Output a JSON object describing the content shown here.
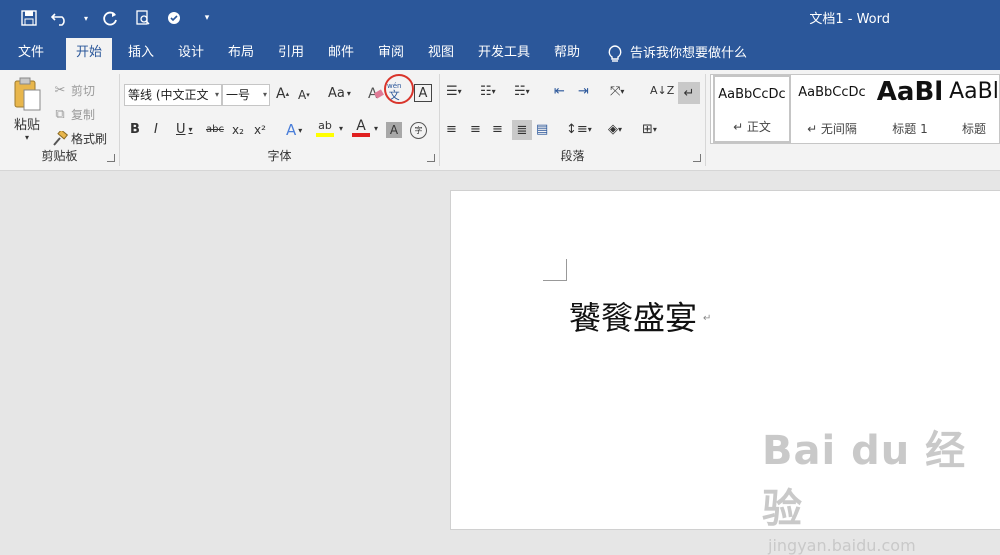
{
  "titlebar": {
    "title": "文档1  -  Word",
    "qat_icons": [
      "save-icon",
      "undo-icon",
      "redo-icon",
      "print-preview-icon",
      "touch-mode-icon",
      "customize-qat-icon"
    ]
  },
  "tabs": [
    {
      "label": "文件"
    },
    {
      "label": "开始"
    },
    {
      "label": "插入"
    },
    {
      "label": "设计"
    },
    {
      "label": "布局"
    },
    {
      "label": "引用"
    },
    {
      "label": "邮件"
    },
    {
      "label": "审阅"
    },
    {
      "label": "视图"
    },
    {
      "label": "开发工具"
    },
    {
      "label": "帮助"
    }
  ],
  "tellme": "告诉我你想要做什么",
  "clipboard": {
    "paste": "粘贴",
    "cut": "剪切",
    "copy": "复制",
    "format_painter": "格式刷",
    "label": "剪贴板"
  },
  "font": {
    "font_name": "等线 (中文正文",
    "font_size": "一号",
    "grow": "A",
    "shrink": "A",
    "case": "Aa",
    "clear": "A",
    "phonetic_top": "wén",
    "phonetic_bottom": "文",
    "border": "A",
    "bold": "B",
    "italic": "I",
    "underline": "U",
    "strike": "abc",
    "sub": "x₂",
    "sup": "x²",
    "effects": "A",
    "highlight": "ab",
    "color": "A",
    "shade": "A",
    "enclose": "字",
    "label": "字体"
  },
  "paragraph": {
    "label": "段落"
  },
  "styles": [
    {
      "sample": "AaBbCcDc",
      "name": "↵ 正文"
    },
    {
      "sample": "AaBbCcDc",
      "name": "↵ 无间隔"
    },
    {
      "sample": "AaBl",
      "name": "标题 1"
    },
    {
      "sample": "AaBl",
      "name": "标题"
    }
  ],
  "document": {
    "text": "饕餮盛宴",
    "paragraph_mark": "↵"
  },
  "watermark": {
    "brand": "Bai du 经验",
    "url": "jingyan.baidu.com"
  }
}
